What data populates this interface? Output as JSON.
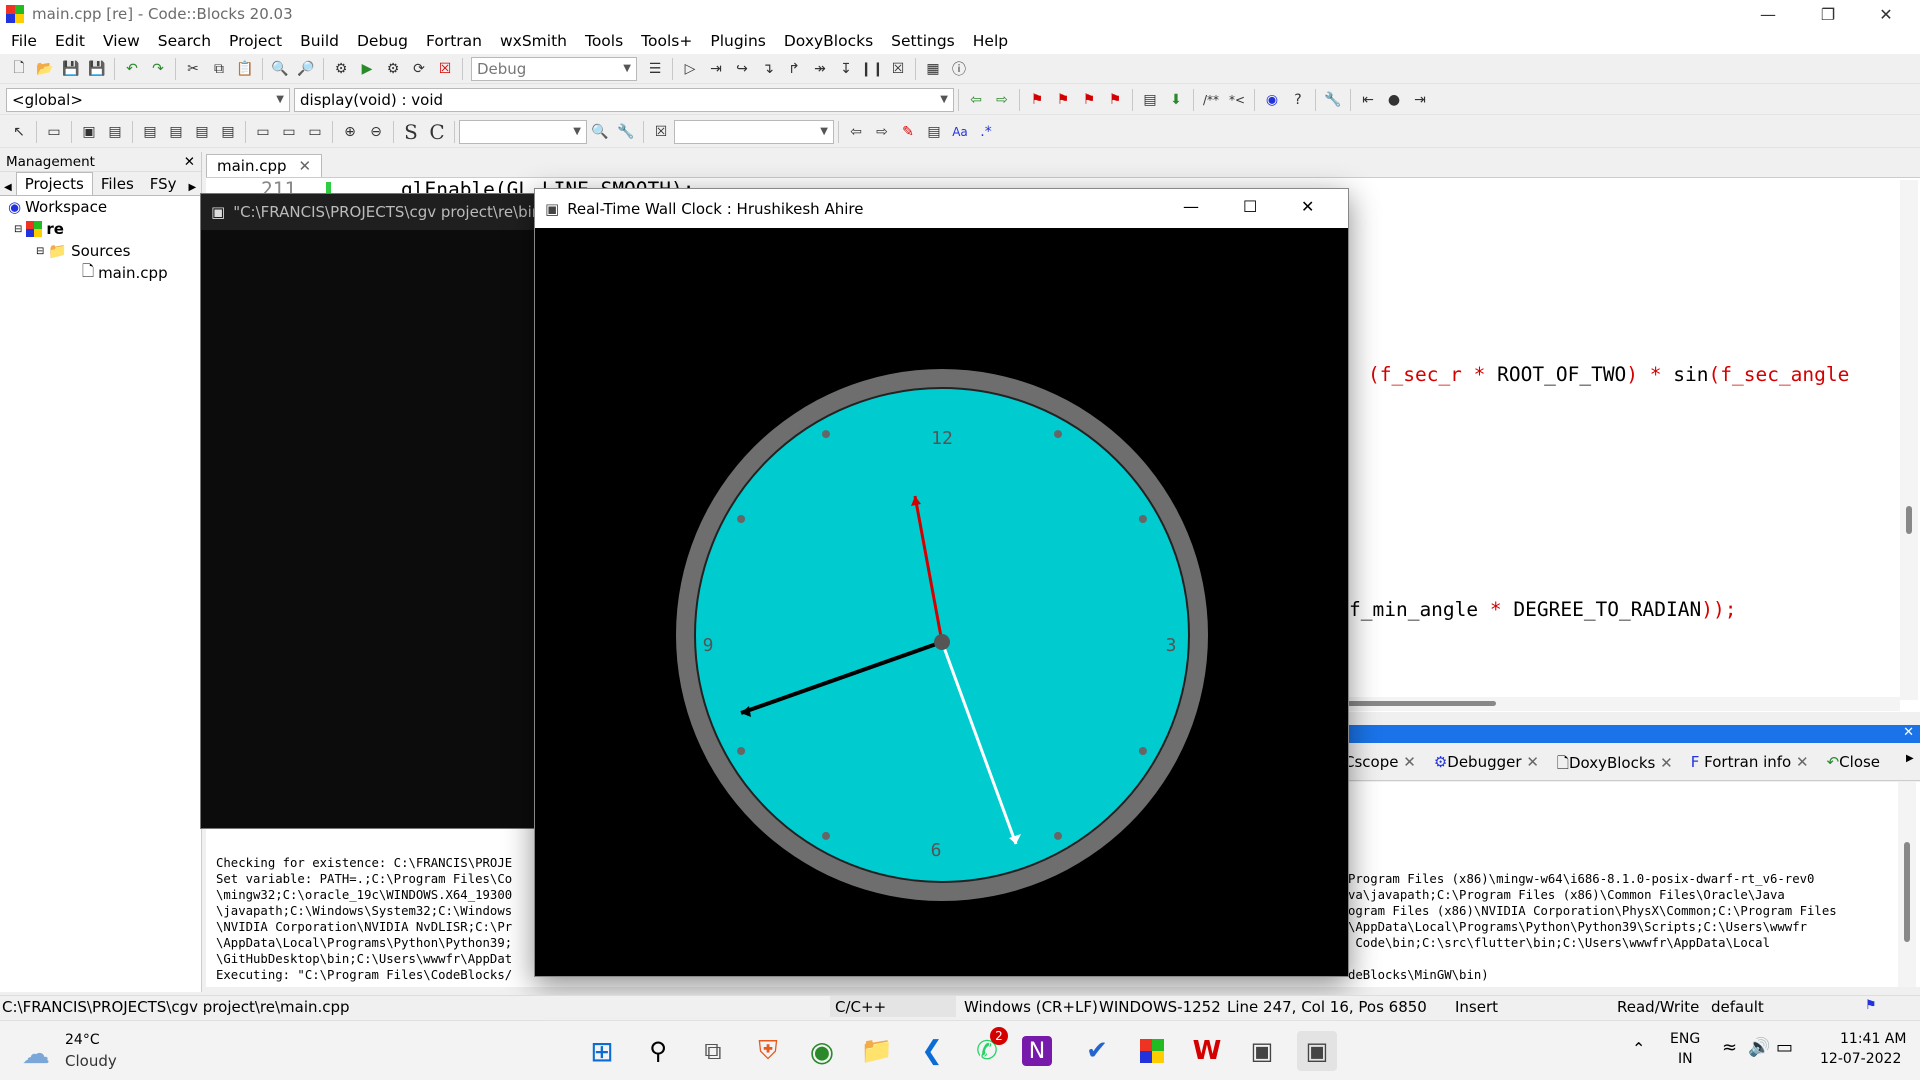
{
  "window_title": "main.cpp [re] - Code::Blocks 20.03",
  "menu": [
    "File",
    "Edit",
    "View",
    "Search",
    "Project",
    "Build",
    "Debug",
    "Fortran",
    "wxSmith",
    "Tools",
    "Tools+",
    "Plugins",
    "DoxyBlocks",
    "Settings",
    "Help"
  ],
  "toolbar": {
    "build_target": "Debug"
  },
  "scope": {
    "global": "<global>",
    "function": "display(void) : void"
  },
  "management": {
    "title": "Management",
    "tabs": [
      "Projects",
      "Files",
      "FSy"
    ],
    "tree": {
      "workspace": "Workspace",
      "project": "re",
      "folder": "Sources",
      "file": "main.cpp"
    }
  },
  "editor": {
    "tab": "main.cpp",
    "line_number": "211",
    "line1": "glEnable(GL_LINE_SMOOTH);",
    "line2_a": "(f_sec_r",
    "line2_b": " * ",
    "line2_c": "ROOT_OF_TWO",
    "line2_d": ") * ",
    "line2_e": "sin",
    "line2_f": "(f_sec_angle",
    "line3_a": "f_min_angle",
    "line3_b": " * ",
    "line3_c": "DEGREE_TO_RADIAN",
    "line3_d": "));"
  },
  "log_tabs": [
    "Cscope",
    "Debugger",
    "DoxyBlocks",
    "Fortran info",
    "Close"
  ],
  "log_left": [
    "Checking for existence: C:\\FRANCIS\\PROJE",
    "Set variable: PATH=.;C:\\Program Files\\Co",
    "\\mingw32;C:\\oracle_19c\\WINDOWS.X64_19300",
    "\\javapath;C:\\Windows\\System32;C:\\Windows",
    "\\NVIDIA Corporation\\NVIDIA NvDLISR;C:\\Pr",
    "\\AppData\\Local\\Programs\\Python\\Python39;",
    "\\GitHubDesktop\\bin;C:\\Users\\wwwfr\\AppDat",
    "Executing: \"C:\\Program Files\\CodeBlocks/"
  ],
  "log_right": [
    "Program Files (x86)\\mingw-w64\\i686-8.1.0-posix-dwarf-rt_v6-rev0",
    "va\\javapath;C:\\Program Files (x86)\\Common Files\\Oracle\\Java",
    "ogram Files (x86)\\NVIDIA Corporation\\PhysX\\Common;C:\\Program Files",
    "\\AppData\\Local\\Programs\\Python\\Python39\\Scripts;C:\\Users\\wwwfr",
    " Code\\bin;C:\\src\\flutter\\bin;C:\\Users\\wwwfr\\AppData\\Local",
    "",
    "deBlocks\\MinGW\\bin)"
  ],
  "console": {
    "title": "\"C:\\FRANCIS\\PROJECTS\\cgv project\\re\\bin\\De"
  },
  "clock_window": {
    "title": "Real-Time Wall Clock : Hrushikesh Ahire",
    "numbers": [
      "12",
      "3",
      "6",
      "9"
    ],
    "face_color": "#00cbcf",
    "rim_color": "#6e6e6e",
    "hour_hand_color": "#000000",
    "minute_hand_color": "#ffffff",
    "second_hand_color": "#d40000"
  },
  "status": {
    "path": "C:\\FRANCIS\\PROJECTS\\cgv project\\re\\main.cpp",
    "lang": "C/C++",
    "eol": "Windows (CR+LF)",
    "encoding": "WINDOWS-1252",
    "position": "Line 247, Col 16, Pos 6850",
    "mode": "Insert",
    "rw": "Read/Write",
    "profile": "default"
  },
  "taskbar": {
    "temp": "24°C",
    "weather": "Cloudy",
    "lang1": "ENG",
    "lang2": "IN",
    "time": "11:41 AM",
    "date": "12-07-2022",
    "whatsapp_badge": "2"
  }
}
